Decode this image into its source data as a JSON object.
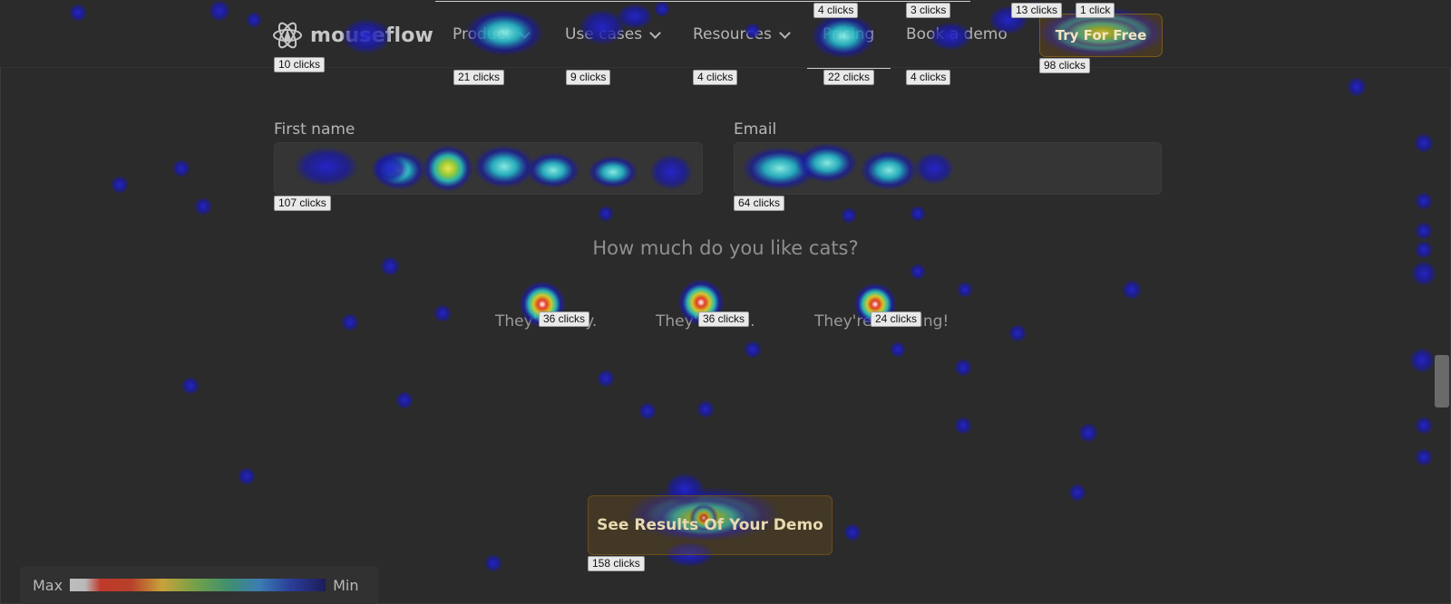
{
  "nav": {
    "logo_text": "mouseflow",
    "items": [
      {
        "label": "Product",
        "chevron": true
      },
      {
        "label": "Use cases",
        "chevron": true
      },
      {
        "label": "Resources",
        "chevron": true
      },
      {
        "label": "Pricing",
        "chevron": false
      },
      {
        "label": "Book a demo",
        "chevron": false
      }
    ],
    "cta_label": "Try For Free"
  },
  "form": {
    "first_name_label": "First name",
    "email_label": "Email",
    "question": "How much do you like cats?",
    "options": [
      "They're okay.",
      "They're nice.",
      "They're amazing!"
    ],
    "submit_label": "See Results Of Your Demo"
  },
  "click_labels": {
    "logo": "10 clicks",
    "product": "21 clicks",
    "use_cases": "9 clicks",
    "resources": "4 clicks",
    "pricing_top": "4 clicks",
    "pricing": "22 clicks",
    "book_demo_top": "3 clicks",
    "book_demo": "4 clicks",
    "cta_top_left": "13 clicks",
    "cta_top_right": "1 click",
    "cta": "98 clicks",
    "first_name": "107 clicks",
    "email": "64 clicks",
    "option_okay": "36 clicks",
    "option_nice": "36 clicks",
    "option_amazing": "24 clicks",
    "submit": "158 clicks"
  },
  "legend": {
    "max_label": "Max",
    "min_label": "Min"
  },
  "colors": {
    "background": "#2b2b2b",
    "heat_low": "#1a1aa8",
    "heat_mid": "#22c0c8",
    "heat_high": "#d6d42a",
    "heat_max": "#d62a1c"
  }
}
